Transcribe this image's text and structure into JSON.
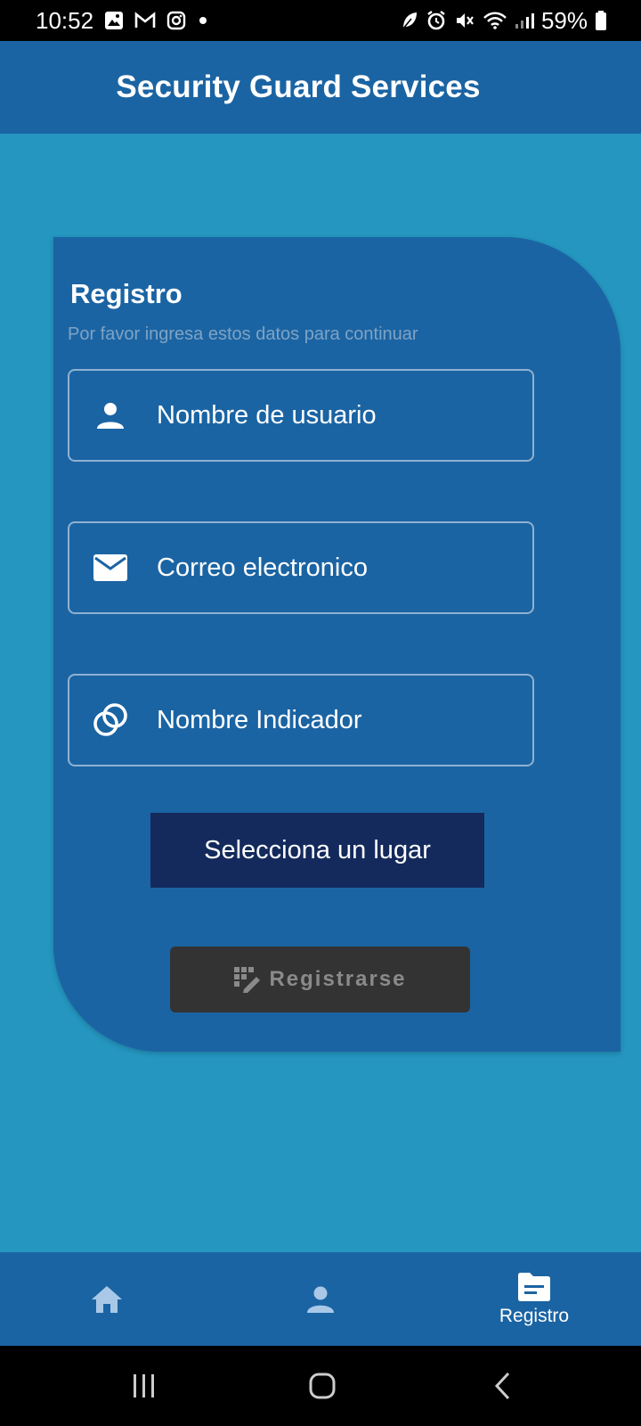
{
  "status_bar": {
    "time": "10:52",
    "battery": "59%",
    "left_icons": [
      "gallery-icon",
      "gmail-icon",
      "instagram-icon",
      "dot-icon"
    ],
    "right_icons": [
      "leaf-icon",
      "alarm-icon",
      "mute-icon",
      "wifi-icon",
      "signal-icon",
      "battery-icon"
    ]
  },
  "app_bar": {
    "title": "Security Guard Services"
  },
  "form": {
    "title": "Registro",
    "subtitle": "Por favor ingresa estos datos para continuar",
    "fields": [
      {
        "label": "Nombre de usuario",
        "icon": "person-icon"
      },
      {
        "label": "Correo electronico",
        "icon": "email-icon"
      },
      {
        "label": "Nombre Indicador",
        "icon": "rings-icon"
      }
    ],
    "select_place_label": "Selecciona un lugar",
    "register_label": "Registrarse"
  },
  "bottom_nav": {
    "items": [
      {
        "icon": "home-icon",
        "label": ""
      },
      {
        "icon": "person-icon",
        "label": ""
      },
      {
        "icon": "folder-icon",
        "label": "Registro",
        "active": true
      }
    ]
  },
  "colors": {
    "background": "#2496c0",
    "primary": "#1b64a3",
    "select_button": "#142a5c",
    "register_button": "#333333"
  }
}
